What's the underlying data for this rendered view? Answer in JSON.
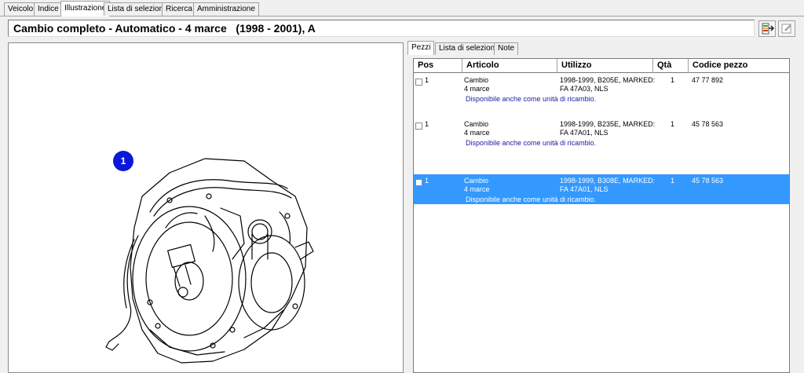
{
  "top_tabs": [
    "Veicolo",
    "Indice",
    "Illustrazione",
    "Lista di selezione",
    "Ricerca",
    "Amministrazione"
  ],
  "title": "Cambio completo - Automatico - 4 marce   (1998 - 2001), A",
  "toolbar": {
    "btn1_icon": "export-icon",
    "btn2_icon": "edit-icon"
  },
  "illustration": {
    "badge": "1"
  },
  "sub_tabs": [
    "Pezzi",
    "Lista di selezione",
    "Note"
  ],
  "table": {
    "headers": [
      "Pos",
      "Articolo",
      "Utilizzo",
      "Qtà",
      "Codice pezzo"
    ],
    "rows": [
      {
        "pos": "1",
        "articolo": "Cambio\n4 marce",
        "utilizzo": "1998-1999, B205E, MARKED:\nFA 47A03, NLS",
        "qta": "1",
        "codice": "47 77 892",
        "note": "Disponibile anche come unità di ricambio."
      },
      {
        "pos": "1",
        "articolo": "Cambio\n4 marce",
        "utilizzo": "1998-1999, B235E, MARKED:\nFA 47A01, NLS",
        "qta": "1",
        "codice": "45 78 563",
        "note": "Disponibile anche come unità di ricambio."
      },
      {
        "pos": "1",
        "articolo": "Cambio\n4 marce",
        "utilizzo": "1998-1999, B308E, MARKED:\nFA 47A01, NLS",
        "qta": "1",
        "codice": "45 78 563",
        "note": "Disponibile anche come unità di ricambio."
      }
    ]
  },
  "colors": {
    "selection": "#3399ff",
    "badge": "#0a18d8",
    "note_text": "#1a1aa6"
  }
}
